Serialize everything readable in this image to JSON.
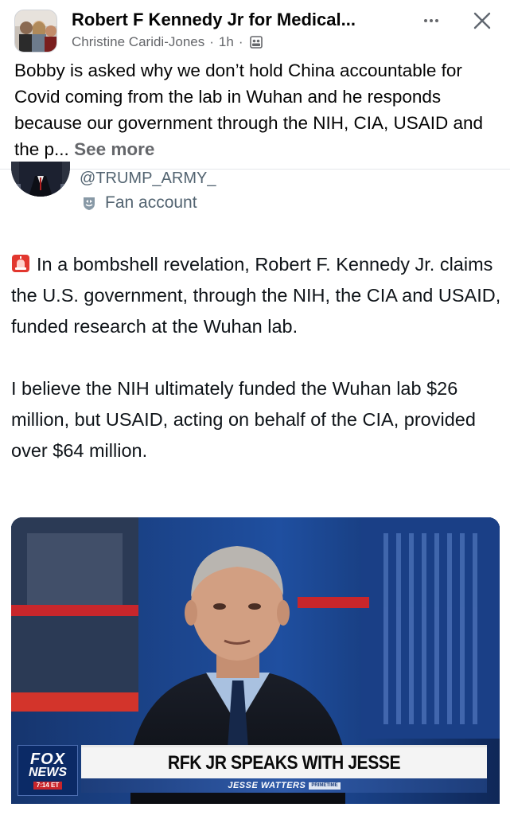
{
  "post": {
    "group_name": "Robert F Kennedy Jr for Medical...",
    "author": "Christine Caridi-Jones",
    "separator": "·",
    "time": "1h",
    "caption": "Bobby is asked why we don’t hold China accountable for Covid coming from the lab in Wuhan and he responds because our government through the NIH, CIA, USAID and the p...",
    "see_more": "See more",
    "privacy_icon": "group-privacy-icon",
    "more_icon": "more-horizontal-icon",
    "close_icon": "close-icon"
  },
  "tweet": {
    "handle": "@TRUMP_ARMY_",
    "badge_icon": "fan-badge-icon",
    "badge_label": "Fan account",
    "alarm_icon": "rotating-light-icon",
    "paragraph_1": "In a bombshell revelation, Robert F. Kennedy Jr. claims the U.S. government, through the NIH, the CIA and USAID, funded research at the Wuhan lab.",
    "paragraph_2": "I believe the NIH ultimately funded the Wuhan lab $26 million, but USAID, acting on behalf of the CIA, provided over $64 million."
  },
  "video": {
    "network_line1": "FOX",
    "network_line2": "NEWS",
    "network_tag": "7:14 ET",
    "headline": "RFK JR SPEAKS WITH JESSE",
    "show_name": "JESSE WATTERS",
    "show_badge": "PRIMETIME"
  },
  "colors": {
    "text": "#050505",
    "secondary": "#65676b",
    "tweet_secondary": "#536471",
    "fox_red": "#c9252b",
    "fox_blue": "#0b2a66"
  }
}
